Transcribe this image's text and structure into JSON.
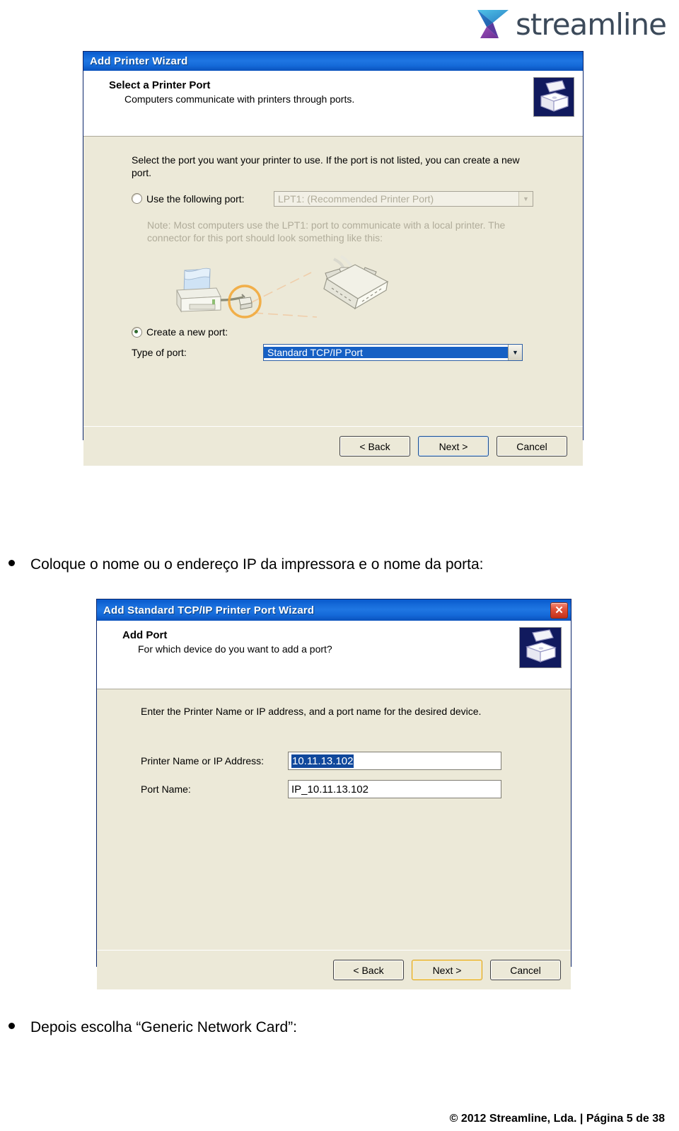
{
  "brand": {
    "name": "streamline",
    "logo_icon": "streamline-logo-icon",
    "colors": {
      "teal": "#1ba0d6",
      "purple": "#8b3fa8",
      "wordmark": "#3c4a5a"
    }
  },
  "dialog1": {
    "title": "Add Printer Wizard",
    "header": {
      "title": "Select a Printer Port",
      "subtitle": "Computers communicate with printers through ports.",
      "icon": "printer-header-icon"
    },
    "instruction": "Select the port you want your printer to use.  If the port is not listed, you can create a new port.",
    "use_following_port": {
      "label": "Use the following port:",
      "selected": false,
      "combo_value": "LPT1: (Recommended Printer Port)",
      "disabled": true
    },
    "note": "Note: Most computers use the LPT1: port to communicate with a local printer. The connector for this port should look something like this:",
    "illustration": "printer-parallel-connector-illustration",
    "create_new_port": {
      "label": "Create a new port:",
      "selected": true,
      "type_label": "Type of port:",
      "combo_value": "Standard TCP/IP Port",
      "focused": true
    },
    "buttons": {
      "back": "< Back",
      "next": "Next >",
      "cancel": "Cancel",
      "default": "next"
    }
  },
  "caption1": "Coloque o nome ou o endereço IP da impressora e o nome da porta:",
  "dialog2": {
    "title": "Add Standard TCP/IP Printer Port Wizard",
    "close_icon": "close-icon",
    "header": {
      "title": "Add Port",
      "subtitle": "For which device do you want to add a port?",
      "icon": "printer-header-icon"
    },
    "instruction": "Enter the Printer Name or IP address, and a port name for the desired device.",
    "fields": [
      {
        "label": "Printer Name or IP Address:",
        "value": "10.11.13.102",
        "selected": true,
        "name": "printer-name-or-ip-field"
      },
      {
        "label": "Port Name:",
        "value": "IP_10.11.13.102",
        "selected": false,
        "name": "port-name-field"
      }
    ],
    "buttons": {
      "back": "< Back",
      "next": "Next >",
      "cancel": "Cancel",
      "default": "next"
    }
  },
  "caption2": "Depois escolha “Generic Network Card”:",
  "footer": "© 2012 Streamline, Lda. | Página  5 de 38"
}
